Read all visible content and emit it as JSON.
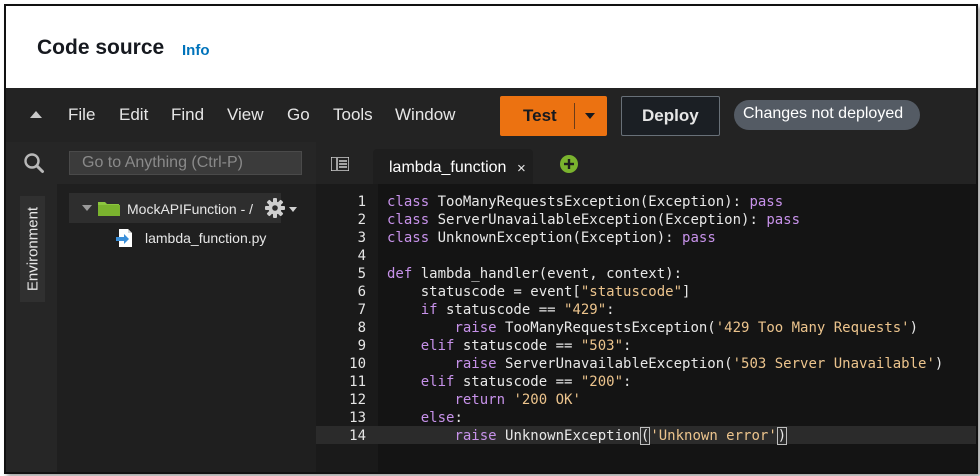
{
  "header": {
    "title": "Code source",
    "info_link": "Info"
  },
  "menubar": {
    "items": [
      "File",
      "Edit",
      "Find",
      "View",
      "Go",
      "Tools",
      "Window"
    ],
    "test_button": "Test",
    "deploy_button": "Deploy",
    "status_badge": "Changes not deployed"
  },
  "search": {
    "placeholder": "Go to Anything (Ctrl-P)"
  },
  "sidebar": {
    "environment_tab": "Environment"
  },
  "file_tree": {
    "folder": "MockAPIFunction - /",
    "file": "lambda_function.py"
  },
  "editor": {
    "tab_label": "lambda_function",
    "tab_close": "×",
    "active_line": 14,
    "lines": [
      "class TooManyRequestsException(Exception): pass",
      "class ServerUnavailableException(Exception): pass",
      "class UnknownException(Exception): pass",
      "",
      "def lambda_handler(event, context):",
      "    statuscode = event[\"statuscode\"]",
      "    if statuscode == \"429\":",
      "        raise TooManyRequestsException('429 Too Many Requests')",
      "    elif statuscode == \"503\":",
      "        raise ServerUnavailableException('503 Server Unavailable')",
      "    elif statuscode == \"200\":",
      "        return '200 OK'",
      "    else:",
      "        raise UnknownException('Unknown error')"
    ]
  },
  "colors": {
    "accent_orange": "#ec7211",
    "info_blue": "#0073bb",
    "keyword": "#c792ea",
    "string": "#ecc48d"
  }
}
